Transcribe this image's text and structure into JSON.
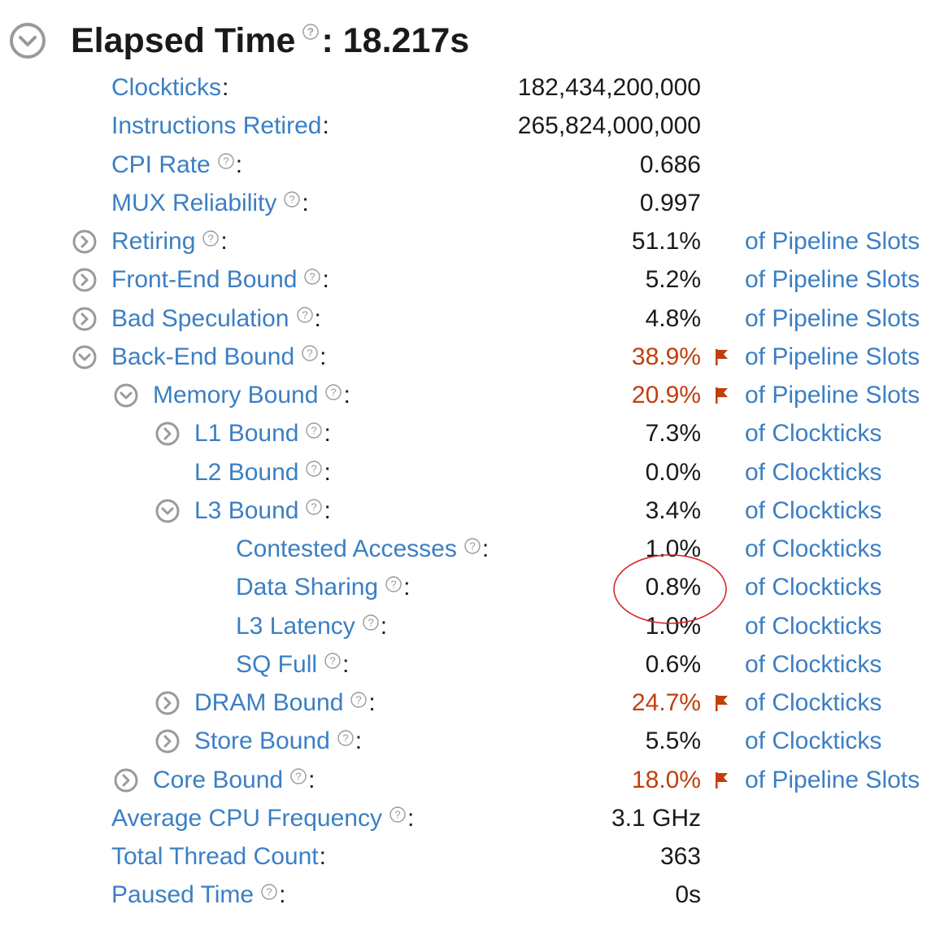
{
  "header": {
    "title": "Elapsed Time",
    "separator": ":",
    "value": "18.217s",
    "toggle_icon": "chevron-down-circle-icon",
    "help_icon": "question-circle-icon"
  },
  "colors": {
    "link": "#3b7fc4",
    "warning": "#c23e0c",
    "text": "#1a1a1a",
    "annotation": "#d62828"
  },
  "metrics": [
    {
      "label": "Clockticks",
      "help": false,
      "value": "182,434,200,000",
      "unit": "",
      "warn": false,
      "expander": "none",
      "level": 0
    },
    {
      "label": "Instructions Retired",
      "help": false,
      "value": "265,824,000,000",
      "unit": "",
      "warn": false,
      "expander": "none",
      "level": 0
    },
    {
      "label": "CPI Rate",
      "help": true,
      "value": "0.686",
      "unit": "",
      "warn": false,
      "expander": "none",
      "level": 0
    },
    {
      "label": "MUX Reliability",
      "help": true,
      "value": "0.997",
      "unit": "",
      "warn": false,
      "expander": "none",
      "level": 0
    },
    {
      "label": "Retiring",
      "help": true,
      "value": "51.1%",
      "unit": "of Pipeline Slots",
      "warn": false,
      "expander": "collapsed",
      "level": 0
    },
    {
      "label": "Front-End Bound",
      "help": true,
      "value": "5.2%",
      "unit": "of Pipeline Slots",
      "warn": false,
      "expander": "collapsed",
      "level": 0
    },
    {
      "label": "Bad Speculation",
      "help": true,
      "value": "4.8%",
      "unit": "of Pipeline Slots",
      "warn": false,
      "expander": "collapsed",
      "level": 0
    },
    {
      "label": "Back-End Bound",
      "help": true,
      "value": "38.9%",
      "unit": "of Pipeline Slots",
      "warn": true,
      "expander": "expanded",
      "level": 0
    },
    {
      "label": "Memory Bound",
      "help": true,
      "value": "20.9%",
      "unit": "of Pipeline Slots",
      "warn": true,
      "expander": "expanded",
      "level": 1
    },
    {
      "label": "L1 Bound",
      "help": true,
      "value": "7.3%",
      "unit": "of Clockticks",
      "warn": false,
      "expander": "collapsed",
      "level": 2
    },
    {
      "label": "L2 Bound",
      "help": true,
      "value": "0.0%",
      "unit": "of Clockticks",
      "warn": false,
      "expander": "none",
      "level": 2
    },
    {
      "label": "L3 Bound",
      "help": true,
      "value": "3.4%",
      "unit": "of Clockticks",
      "warn": false,
      "expander": "expanded",
      "level": 2
    },
    {
      "label": "Contested Accesses",
      "help": true,
      "value": "1.0%",
      "unit": "of Clockticks",
      "warn": false,
      "expander": "none",
      "level": 3
    },
    {
      "label": "Data Sharing",
      "help": true,
      "value": "0.8%",
      "unit": "of Clockticks",
      "warn": false,
      "expander": "none",
      "level": 3
    },
    {
      "label": "L3 Latency",
      "help": true,
      "value": "1.0%",
      "unit": "of Clockticks",
      "warn": false,
      "expander": "none",
      "level": 3
    },
    {
      "label": "SQ Full",
      "help": true,
      "value": "0.6%",
      "unit": "of Clockticks",
      "warn": false,
      "expander": "none",
      "level": 3
    },
    {
      "label": "DRAM Bound",
      "help": true,
      "value": "24.7%",
      "unit": "of Clockticks",
      "warn": true,
      "expander": "collapsed",
      "level": 2
    },
    {
      "label": "Store Bound",
      "help": true,
      "value": "5.5%",
      "unit": "of Clockticks",
      "warn": false,
      "expander": "collapsed",
      "level": 2
    },
    {
      "label": "Core Bound",
      "help": true,
      "value": "18.0%",
      "unit": "of Pipeline Slots",
      "warn": true,
      "expander": "collapsed",
      "level": 1
    },
    {
      "label": "Average CPU Frequency",
      "help": true,
      "value": "3.1 GHz",
      "unit": "",
      "warn": false,
      "expander": "none",
      "level": 0
    },
    {
      "label": "Total Thread Count",
      "help": false,
      "value": "363",
      "unit": "",
      "warn": false,
      "expander": "none",
      "level": 0
    },
    {
      "label": "Paused Time",
      "help": true,
      "value": "0s",
      "unit": "",
      "warn": false,
      "expander": "none",
      "level": 0
    }
  ],
  "annotation": {
    "shape": "ellipse",
    "highlights_metric": "Data Sharing"
  }
}
